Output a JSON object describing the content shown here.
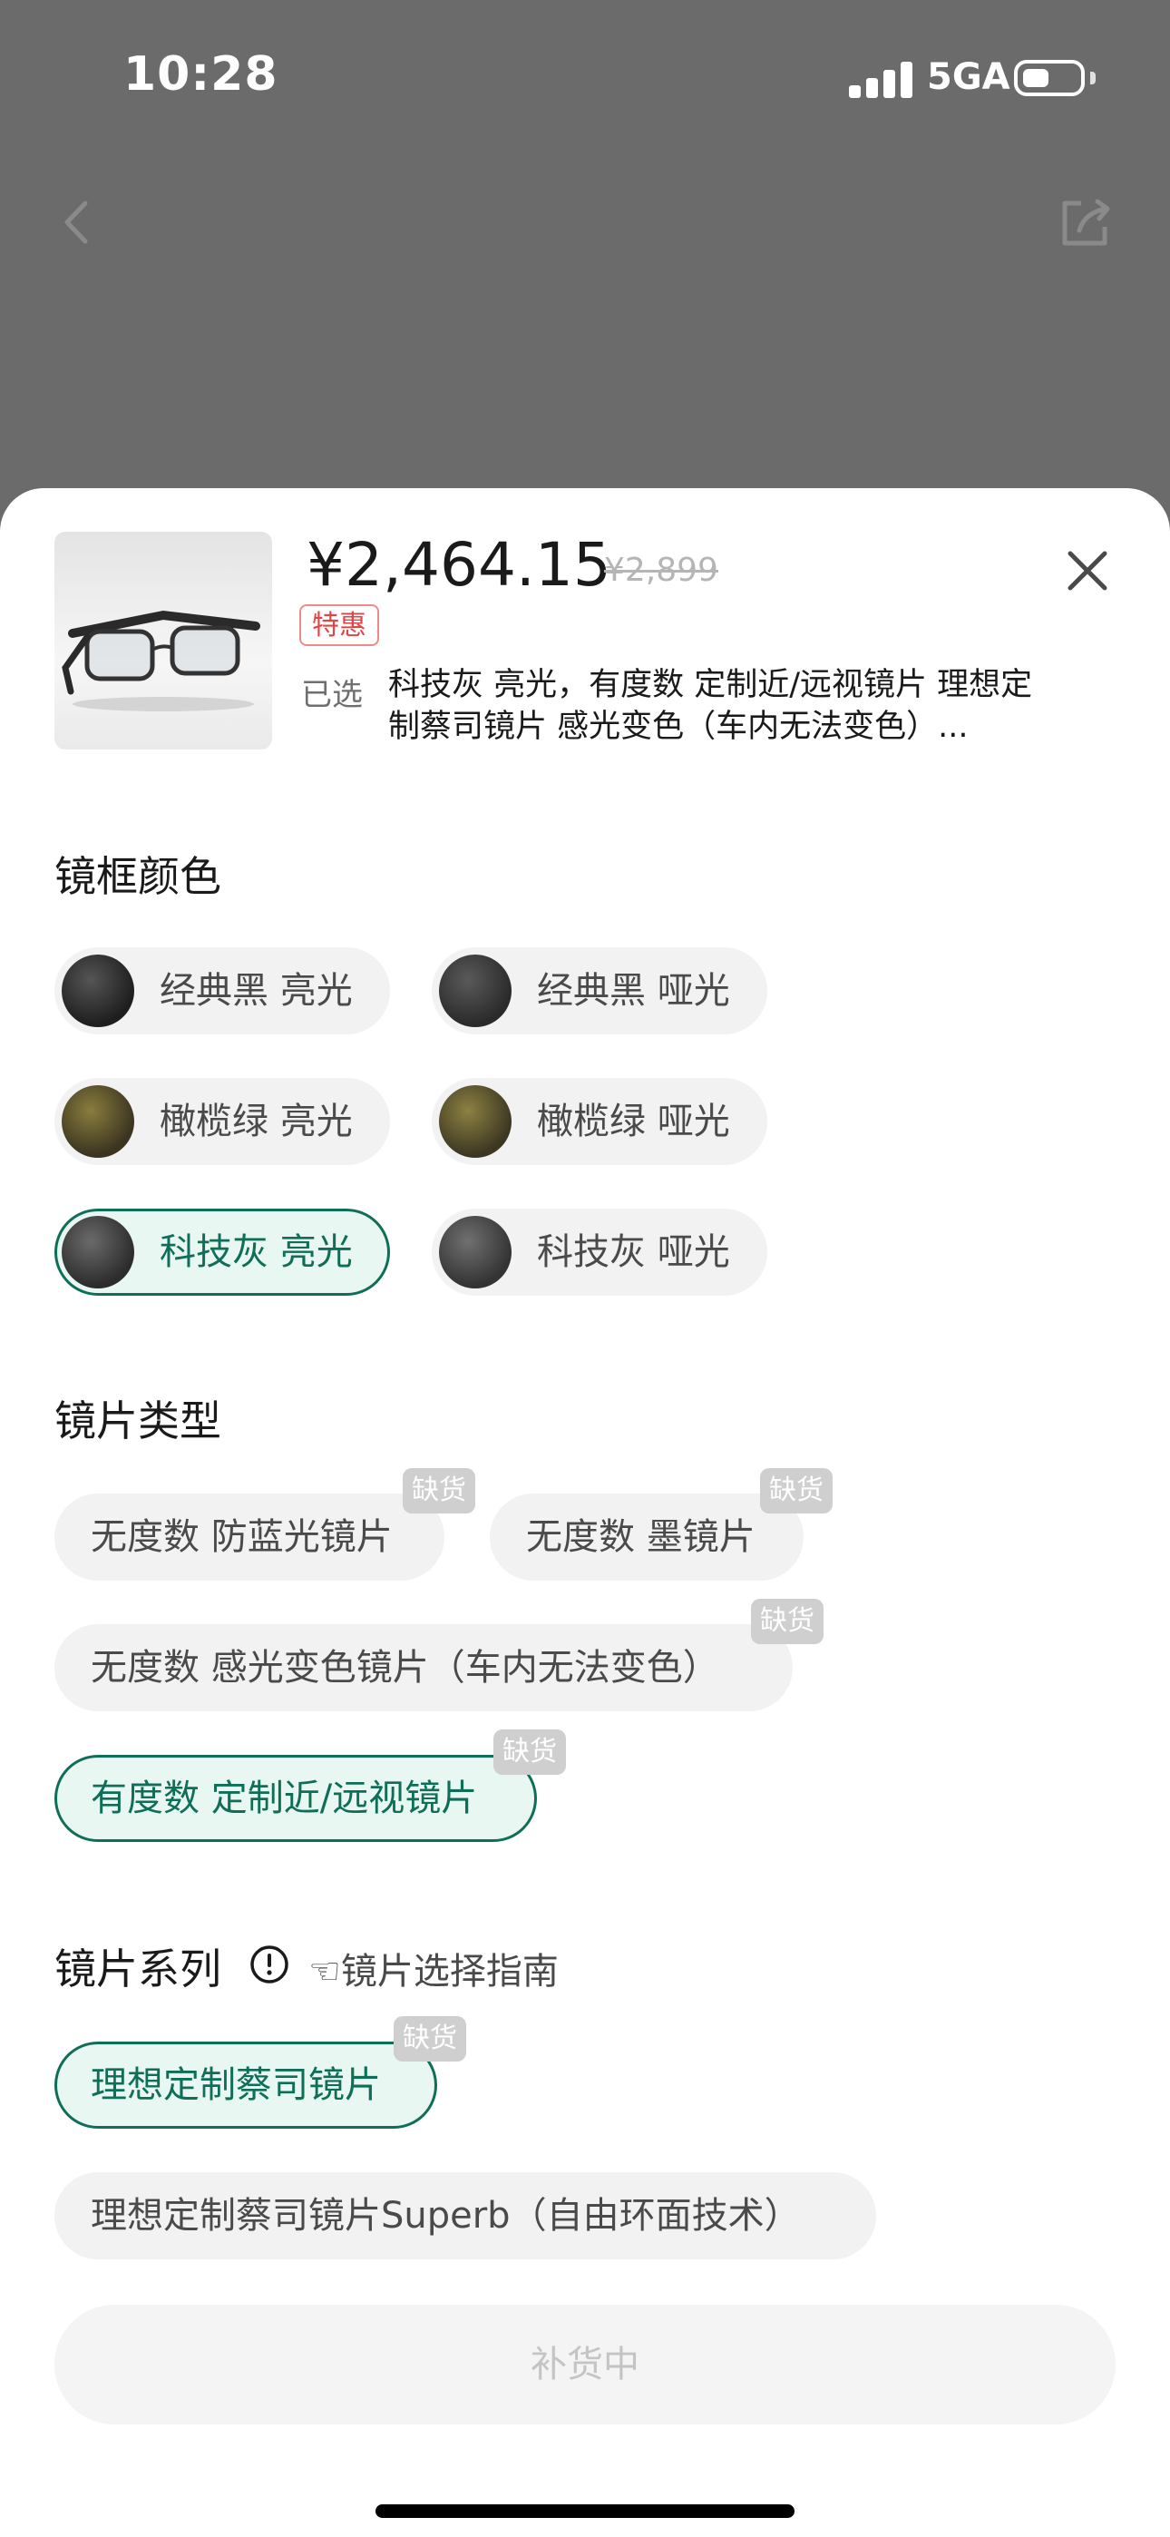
{
  "status_bar": {
    "time": "10:28",
    "network": "5GA"
  },
  "product": {
    "price": "¥2,464.15",
    "original_price": "¥2,899",
    "promo_tag": "特惠",
    "selected_label": "已选",
    "selected_value": "科技灰 亮光，有度数 定制近/远视镜片 理想定制蔡司镜片 感光变色（车内无法变色）..."
  },
  "frame_color": {
    "title": "镜框颜色",
    "options": [
      {
        "label": "经典黑 亮光",
        "swatch": "#2a2a2a",
        "selected": false
      },
      {
        "label": "经典黑 哑光",
        "swatch": "#3a3a3a",
        "selected": false
      },
      {
        "label": "橄榄绿 亮光",
        "swatch": "#5a5230",
        "selected": false
      },
      {
        "label": "橄榄绿 哑光",
        "swatch": "#5c5434",
        "selected": false
      },
      {
        "label": "科技灰 亮光",
        "swatch": "#4a4a4a",
        "selected": true
      },
      {
        "label": "科技灰 哑光",
        "swatch": "#555555",
        "selected": false
      }
    ]
  },
  "lens_type": {
    "title": "镜片类型",
    "options": [
      {
        "label": "无度数 防蓝光镜片",
        "badge": "缺货",
        "selected": false
      },
      {
        "label": "无度数 墨镜片",
        "badge": "缺货",
        "selected": false
      },
      {
        "label": "无度数 感光变色镜片（车内无法变色）",
        "badge": "缺货",
        "selected": false
      },
      {
        "label": "有度数 定制近/远视镜片",
        "badge": "缺货",
        "selected": true
      }
    ]
  },
  "lens_series": {
    "title": "镜片系列",
    "guide": "☜镜片选择指南",
    "options": [
      {
        "label": "理想定制蔡司镜片",
        "badge": "缺货",
        "selected": true
      },
      {
        "label": "理想定制蔡司镜片Superb（自由环面技术）",
        "badge": "",
        "selected": false
      }
    ]
  },
  "action": {
    "restock_label": "补货中"
  },
  "icons": {
    "back": "chevron-left-icon",
    "share": "share-icon",
    "close": "close-icon",
    "info": "info-icon"
  }
}
